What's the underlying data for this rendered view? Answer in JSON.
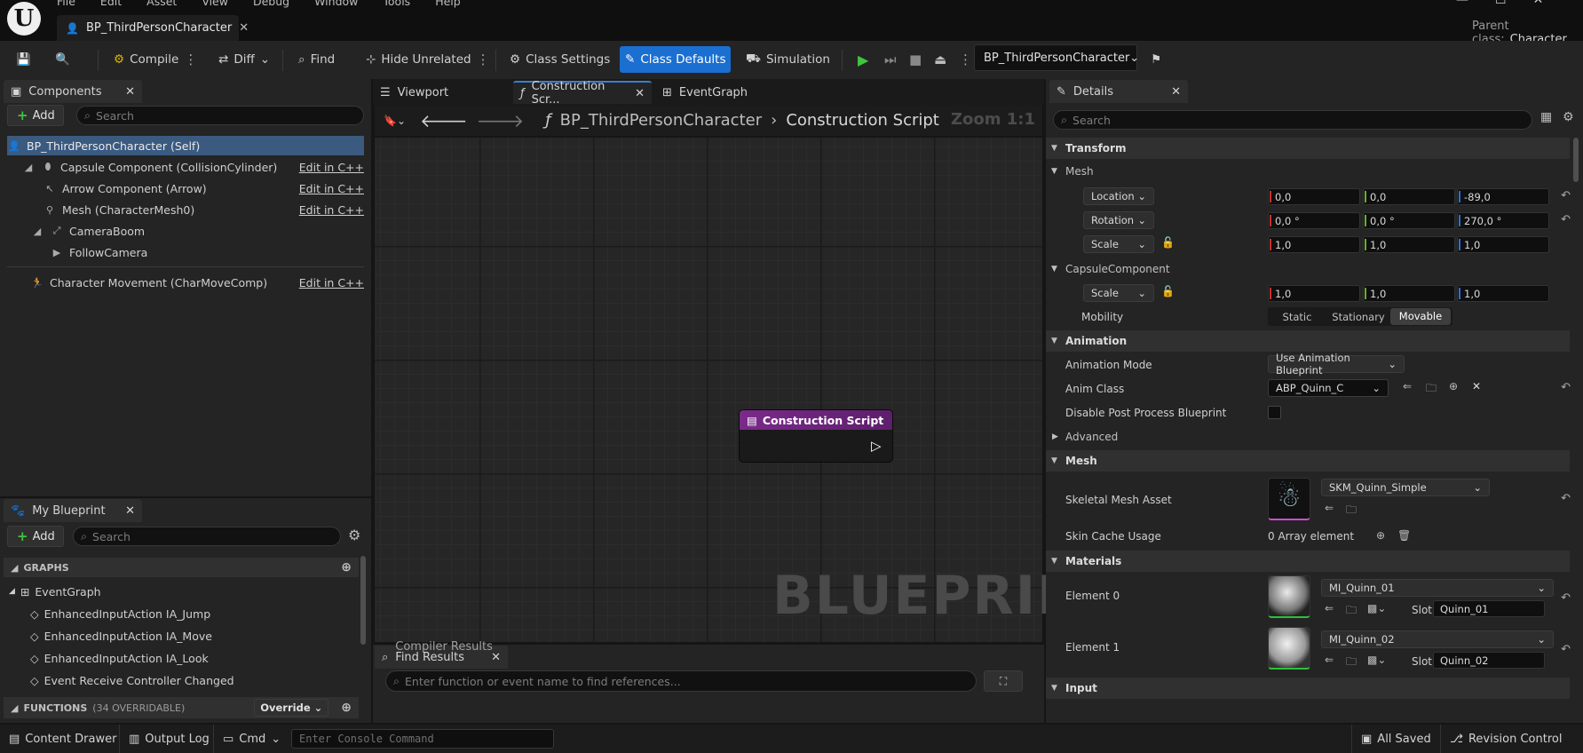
{
  "menu": [
    "File",
    "Edit",
    "Asset",
    "View",
    "Debug",
    "Window",
    "Tools",
    "Help"
  ],
  "document_tab": "BP_ThirdPersonCharacter",
  "parent_class": {
    "label": "Parent class:",
    "value": "Character"
  },
  "toolbar": {
    "compile": "Compile",
    "diff": "Diff",
    "find": "Find",
    "hide_unrelated": "Hide Unrelated",
    "class_settings": "Class Settings",
    "class_defaults": "Class Defaults",
    "simulation": "Simulation",
    "blueprint_select": "BP_ThirdPersonCharacter"
  },
  "components": {
    "tab": "Components",
    "add": "Add",
    "search_placeholder": "Search",
    "items": [
      {
        "label": "BP_ThirdPersonCharacter (Self)",
        "edit": ""
      },
      {
        "label": "Capsule Component (CollisionCylinder)",
        "edit": "Edit in C++"
      },
      {
        "label": "Arrow Component (Arrow)",
        "edit": "Edit in C++"
      },
      {
        "label": "Mesh (CharacterMesh0)",
        "edit": "Edit in C++"
      },
      {
        "label": "CameraBoom",
        "edit": ""
      },
      {
        "label": "FollowCamera",
        "edit": ""
      },
      {
        "label": "Character Movement (CharMoveComp)",
        "edit": "Edit in C++"
      }
    ]
  },
  "my_blueprint": {
    "tab": "My Blueprint",
    "add": "Add",
    "search_placeholder": "Search",
    "graphs_header": "GRAPHS",
    "event_graph": "EventGraph",
    "events": [
      "EnhancedInputAction IA_Jump",
      "EnhancedInputAction IA_Move",
      "EnhancedInputAction IA_Look",
      "Event Receive Controller Changed"
    ],
    "functions_header": "FUNCTIONS",
    "functions_count": "(34 OVERRIDABLE)",
    "override": "Override"
  },
  "editor_tabs": [
    "Viewport",
    "Construction Scr...",
    "EventGraph"
  ],
  "graph": {
    "breadcrumb_root": "BP_ThirdPersonCharacter",
    "breadcrumb_leaf": "Construction Script",
    "zoom": "Zoom 1:1",
    "node_title": "Construction Script",
    "watermark": "BLUEPRINT"
  },
  "find_results": {
    "tab_front": "Compiler Results",
    "tab_back": "Find Results",
    "placeholder": "Enter function or event name to find references..."
  },
  "details": {
    "tab": "Details",
    "search_placeholder": "Search",
    "transform": "Transform",
    "mesh_sub": "Mesh",
    "location": {
      "label": "Location",
      "x": "0,0",
      "y": "0,0",
      "z": "-89,0"
    },
    "rotation": {
      "label": "Rotation",
      "x": "0,0 °",
      "y": "0,0 °",
      "z": "270,0 °"
    },
    "scale": {
      "label": "Scale",
      "x": "1,0",
      "y": "1,0",
      "z": "1,0"
    },
    "capsule_sub": "CapsuleComponent",
    "capsule_scale": {
      "label": "Scale",
      "x": "1,0",
      "y": "1,0",
      "z": "1,0"
    },
    "mobility": {
      "label": "Mobility",
      "options": [
        "Static",
        "Stationary",
        "Movable"
      ],
      "selected": "Movable"
    },
    "animation": "Animation",
    "animation_mode": {
      "label": "Animation Mode",
      "value": "Use Animation Blueprint"
    },
    "anim_class": {
      "label": "Anim Class",
      "value": "ABP_Quinn_C"
    },
    "disable_post": {
      "label": "Disable Post Process Blueprint"
    },
    "advanced": "Advanced",
    "mesh": "Mesh",
    "skeletal": {
      "label": "Skeletal Mesh Asset",
      "value": "SKM_Quinn_Simple"
    },
    "skin_cache": {
      "label": "Skin Cache Usage",
      "value": "0 Array element"
    },
    "materials": "Materials",
    "element0": {
      "label": "Element 0",
      "value": "MI_Quinn_01",
      "slot_label": "Slot",
      "slot": "Quinn_01"
    },
    "element1": {
      "label": "Element 1",
      "value": "MI_Quinn_02",
      "slot_label": "Slot",
      "slot": "Quinn_02"
    },
    "input": "Input"
  },
  "statusbar": {
    "content_drawer": "Content Drawer",
    "output_log": "Output Log",
    "cmd": "Cmd",
    "console_placeholder": "Enter Console Command",
    "all_saved": "All Saved",
    "revision_control": "Revision Control"
  }
}
